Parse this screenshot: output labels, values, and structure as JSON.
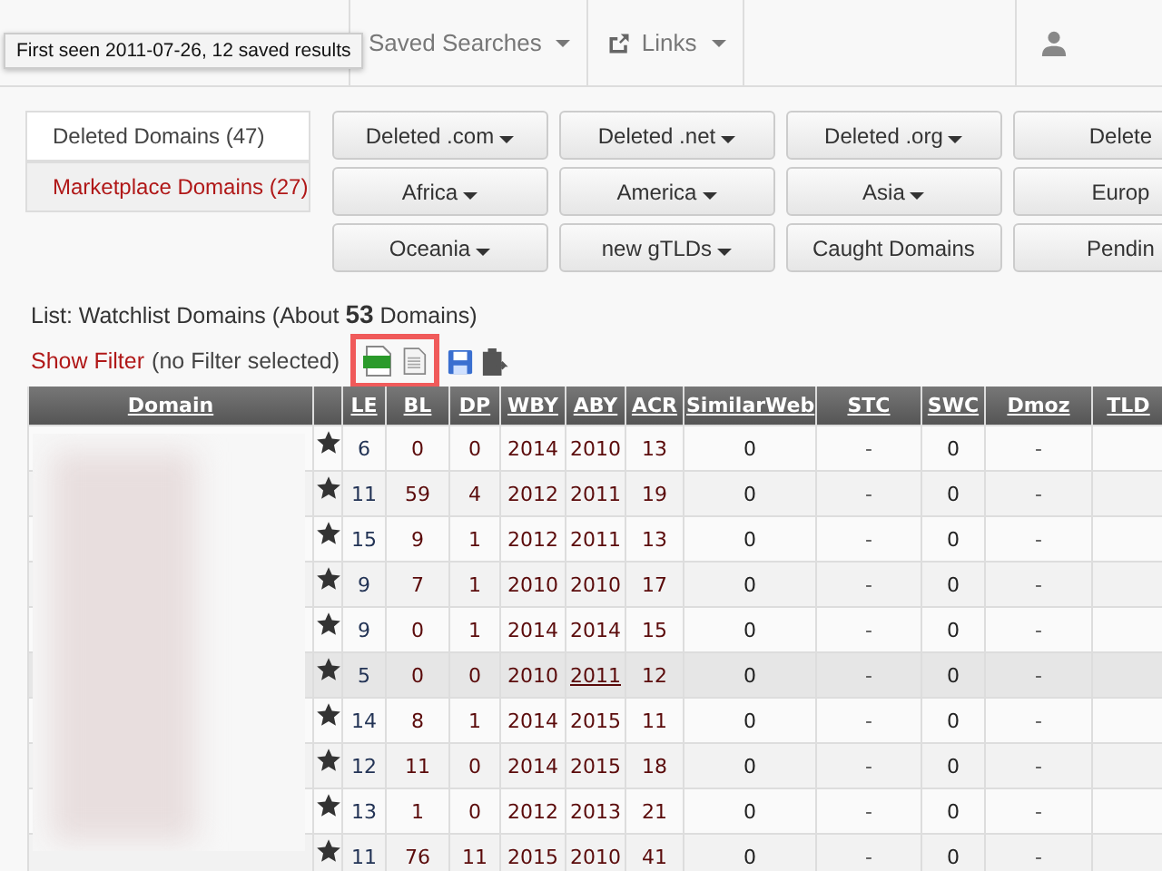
{
  "tooltip": "First seen 2011-07-26, 12 saved results",
  "nav": [
    {
      "label": "Saved Searches"
    },
    {
      "label": "Links"
    }
  ],
  "side_tabs": [
    {
      "label": "Deleted Domains (47)",
      "selected": true
    },
    {
      "label": "Marketplace Domains (27)",
      "selected": false
    }
  ],
  "filter_buttons": [
    {
      "label": "Deleted .com",
      "dropdown": true
    },
    {
      "label": "Deleted .net",
      "dropdown": true
    },
    {
      "label": "Deleted .org",
      "dropdown": true
    },
    {
      "label": "Delete",
      "dropdown": false
    },
    {
      "label": "Africa",
      "dropdown": true
    },
    {
      "label": "America",
      "dropdown": true
    },
    {
      "label": "Asia",
      "dropdown": true
    },
    {
      "label": "Europ",
      "dropdown": false
    },
    {
      "label": "Oceania",
      "dropdown": true
    },
    {
      "label": "new gTLDs",
      "dropdown": true
    },
    {
      "label": "Caught Domains",
      "dropdown": false
    },
    {
      "label": "Pendin",
      "dropdown": false
    }
  ],
  "list_title": "List: Watchlist Domains (About **53** Domains)",
  "show_filter": "Show Filter",
  "filter_note": "(no Filter selected)",
  "table": {
    "columns": [
      "Domain",
      "",
      "LE",
      "BL",
      "DP",
      "WBY",
      "ABY",
      "ACR",
      "SimilarWeb",
      "STC",
      "SWC",
      "Dmoz",
      "TLD"
    ],
    "rows": [
      {
        "highlighted": false,
        "cells": [
          "",
          "",
          "6",
          "0",
          "0",
          "2014",
          "2010",
          "13",
          "0",
          "-",
          "0",
          "-"
        ]
      },
      {
        "highlighted": false,
        "cells": [
          "",
          "",
          "11",
          "59",
          "4",
          "2012",
          "2011",
          "19",
          "0",
          "-",
          "0",
          "-"
        ]
      },
      {
        "highlighted": false,
        "cells": [
          "",
          "",
          "15",
          "9",
          "1",
          "2012",
          "2011",
          "13",
          "0",
          "-",
          "0",
          "-"
        ]
      },
      {
        "highlighted": false,
        "cells": [
          "",
          "",
          "9",
          "7",
          "1",
          "2010",
          "2010",
          "17",
          "0",
          "-",
          "0",
          "-"
        ]
      },
      {
        "highlighted": false,
        "cells": [
          "",
          "",
          "9",
          "0",
          "1",
          "2014",
          "2014",
          "15",
          "0",
          "-",
          "0",
          "-"
        ]
      },
      {
        "highlighted": true,
        "cells": [
          "",
          "",
          "5",
          "0",
          "0",
          "2010",
          "2011",
          "12",
          "0",
          "-",
          "0",
          "-"
        ]
      },
      {
        "highlighted": false,
        "cells": [
          "",
          "",
          "14",
          "8",
          "1",
          "2014",
          "2015",
          "11",
          "0",
          "-",
          "0",
          "-"
        ]
      },
      {
        "highlighted": false,
        "cells": [
          "",
          "",
          "12",
          "11",
          "0",
          "2014",
          "2015",
          "18",
          "0",
          "-",
          "0",
          "-"
        ]
      },
      {
        "highlighted": false,
        "cells": [
          "",
          "",
          "13",
          "1",
          "0",
          "2012",
          "2013",
          "21",
          "0",
          "-",
          "0",
          "-"
        ]
      },
      {
        "highlighted": false,
        "cells": [
          "",
          "",
          "11",
          "76",
          "11",
          "2015",
          "2010",
          "41",
          "0",
          "-",
          "0",
          "-"
        ]
      }
    ]
  }
}
